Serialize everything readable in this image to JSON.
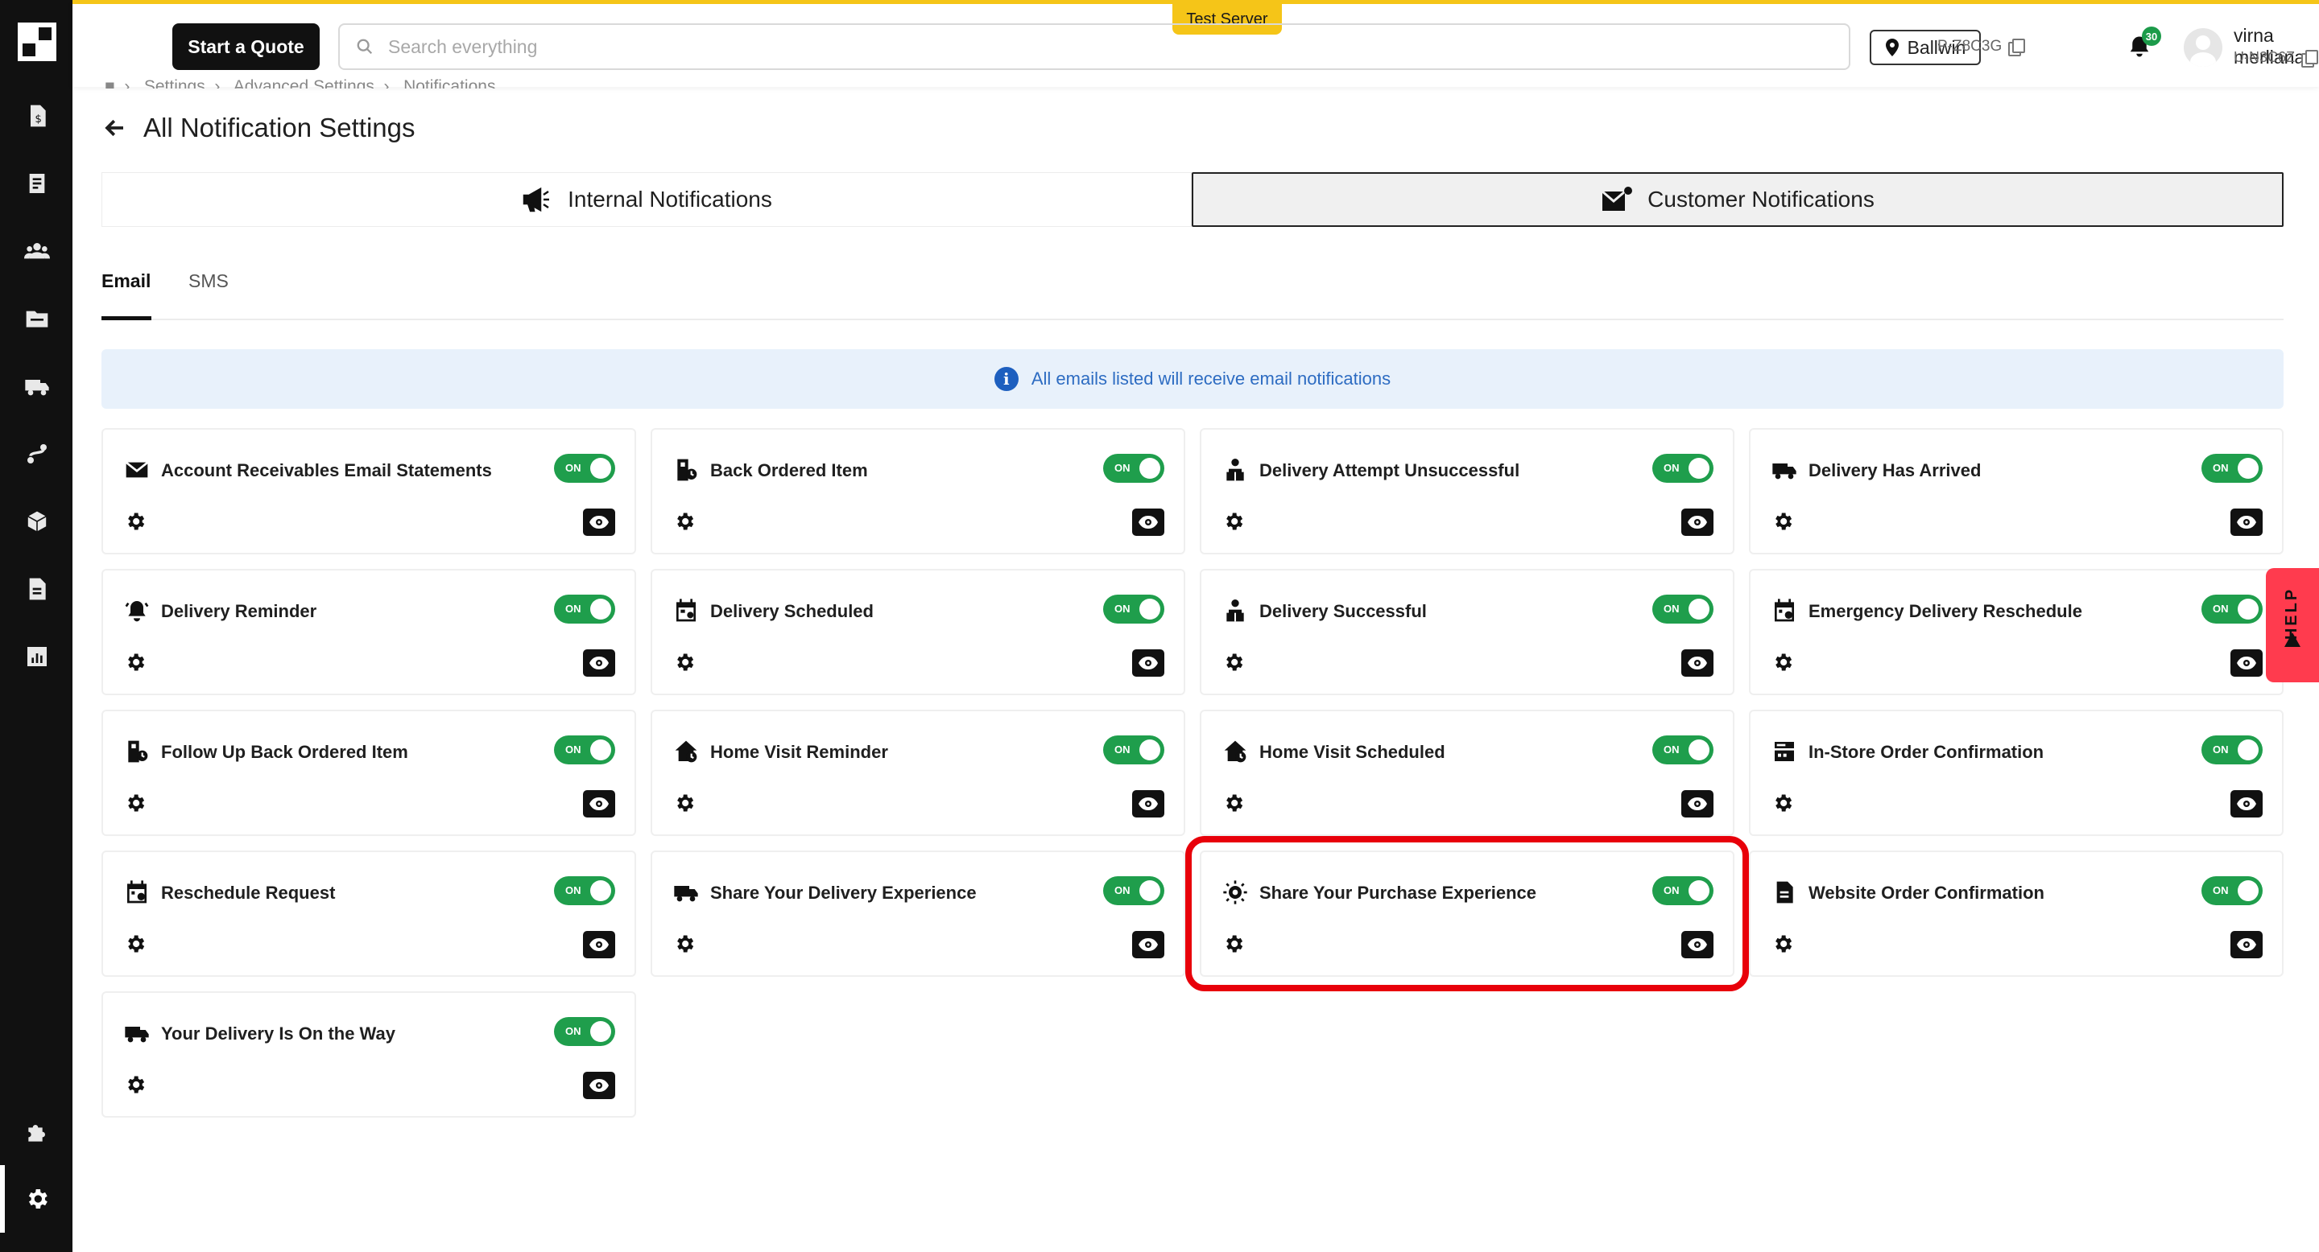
{
  "topbar": {
    "quote_button": "Start a Quote",
    "search_placeholder": "Search everything",
    "test_server": "Test Server",
    "location": "Ballwin",
    "project_code": "P-Z8C3G",
    "notification_count": "30",
    "user_name": "virna merliana",
    "user_code": "U-N3C6Z"
  },
  "breadcrumb": [
    "Settings",
    "Advanced Settings",
    "Notifications"
  ],
  "page": {
    "title": "All Notification Settings"
  },
  "notif_tabs": [
    {
      "label": "Internal Notifications",
      "icon": "megaphone-icon",
      "active": false
    },
    {
      "label": "Customer Notifications",
      "icon": "mail-icon",
      "active": true
    }
  ],
  "sub_tabs": [
    {
      "label": "Email",
      "active": true
    },
    {
      "label": "SMS",
      "active": false
    }
  ],
  "info_banner": "All emails listed will receive email notifications",
  "toggle_label": "ON",
  "help_label": "HELP",
  "colors": {
    "accent_yellow": "#f5c518",
    "toggle_green": "#1f9e4c",
    "highlight_red": "#e8000a",
    "banner_blue": "#e8f1fb"
  },
  "cards": [
    {
      "title": "Account Receivables Email Statements",
      "icon": "envelope-icon",
      "enabled": true,
      "highlighted": false
    },
    {
      "title": "Back Ordered Item",
      "icon": "backorder-icon",
      "enabled": true,
      "highlighted": false
    },
    {
      "title": "Delivery Attempt Unsuccessful",
      "icon": "delivery-person-icon",
      "enabled": true,
      "highlighted": false
    },
    {
      "title": "Delivery Has Arrived",
      "icon": "truck-icon",
      "enabled": true,
      "highlighted": false
    },
    {
      "title": "Delivery Reminder",
      "icon": "bell-ring-icon",
      "enabled": true,
      "highlighted": false
    },
    {
      "title": "Delivery Scheduled",
      "icon": "calendar-icon",
      "enabled": true,
      "highlighted": false
    },
    {
      "title": "Delivery Successful",
      "icon": "delivery-person-icon",
      "enabled": true,
      "highlighted": false
    },
    {
      "title": "Emergency Delivery Reschedule",
      "icon": "calendar-alert-icon",
      "enabled": true,
      "highlighted": false
    },
    {
      "title": "Follow Up Back Ordered Item",
      "icon": "backorder-icon",
      "enabled": true,
      "highlighted": false
    },
    {
      "title": "Home Visit Reminder",
      "icon": "home-clock-icon",
      "enabled": true,
      "highlighted": false
    },
    {
      "title": "Home Visit Scheduled",
      "icon": "home-clock-icon",
      "enabled": true,
      "highlighted": false
    },
    {
      "title": "In-Store Order Confirmation",
      "icon": "register-icon",
      "enabled": true,
      "highlighted": false
    },
    {
      "title": "Reschedule Request",
      "icon": "calendar-alert-icon",
      "enabled": true,
      "highlighted": false
    },
    {
      "title": "Share Your Delivery Experience",
      "icon": "truck-icon",
      "enabled": true,
      "highlighted": false
    },
    {
      "title": "Share Your Purchase Experience",
      "icon": "badge-icon",
      "enabled": true,
      "highlighted": true
    },
    {
      "title": "Website Order Confirmation",
      "icon": "document-icon",
      "enabled": true,
      "highlighted": false
    },
    {
      "title": "Your Delivery Is On the Way",
      "icon": "truck-icon",
      "enabled": true,
      "highlighted": false
    }
  ],
  "sidebar": {
    "items": [
      {
        "name": "quotes",
        "icon": "dollar-doc-icon"
      },
      {
        "name": "orders",
        "icon": "receipt-icon"
      },
      {
        "name": "customers",
        "icon": "users-icon"
      },
      {
        "name": "projects",
        "icon": "folder-icon"
      },
      {
        "name": "deliveries",
        "icon": "truck-icon"
      },
      {
        "name": "routes",
        "icon": "route-icon"
      },
      {
        "name": "inventory",
        "icon": "box-icon"
      },
      {
        "name": "documents",
        "icon": "file-icon"
      },
      {
        "name": "reports",
        "icon": "chart-icon"
      },
      {
        "name": "integrations",
        "icon": "puzzle-icon"
      },
      {
        "name": "settings",
        "icon": "gear-icon"
      }
    ]
  }
}
